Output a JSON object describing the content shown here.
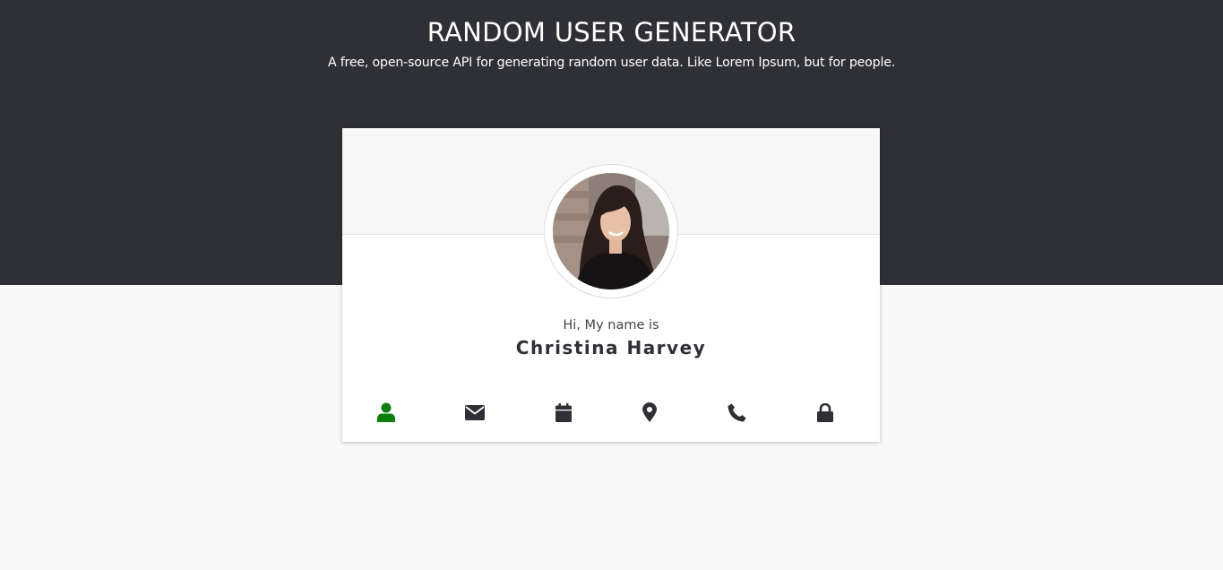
{
  "header": {
    "title": "RANDOM USER GENERATOR",
    "subtitle": "A free, open-source API for generating random user data. Like Lorem Ipsum, but for people."
  },
  "card": {
    "user_title": "Hi, My name is",
    "user_value": "Christina Harvey",
    "icons": [
      {
        "name": "name-icon",
        "icon": "person-icon",
        "active": true
      },
      {
        "name": "email-icon",
        "icon": "envelope-icon",
        "active": false
      },
      {
        "name": "birthday-icon",
        "icon": "calendar-icon",
        "active": false
      },
      {
        "name": "location-icon",
        "icon": "map-marker-icon",
        "active": false
      },
      {
        "name": "phone-icon",
        "icon": "phone-icon",
        "active": false
      },
      {
        "name": "password-icon",
        "icon": "lock-icon",
        "active": false
      }
    ]
  },
  "colors": {
    "hero_background": "#2f3036",
    "page_background": "#f9f9f9",
    "active_icon": "#0c7e0c",
    "inactive_icon": "#2f3036"
  }
}
